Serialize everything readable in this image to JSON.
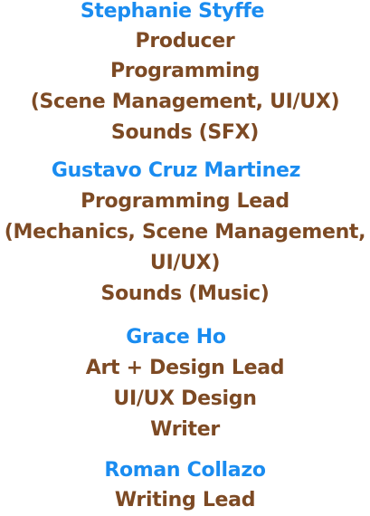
{
  "credits": {
    "colors": {
      "name": "#1a8cf0",
      "role": "#7d4a24"
    },
    "people": [
      {
        "name": "Stephanie Styffe",
        "roles": [
          "Producer",
          "Programming",
          "(Scene Management, UI/UX)",
          "Sounds (SFX)"
        ]
      },
      {
        "name": "Gustavo Cruz Martinez",
        "roles": [
          "Programming Lead",
          "(Mechanics, Scene Management,",
          "UI/UX)",
          "Sounds (Music)"
        ]
      },
      {
        "name": "Grace Ho",
        "roles": [
          "Art + Design Lead",
          "UI/UX Design",
          "Writer"
        ]
      },
      {
        "name": "Roman Collazo",
        "roles": [
          "Writing Lead"
        ]
      }
    ]
  }
}
